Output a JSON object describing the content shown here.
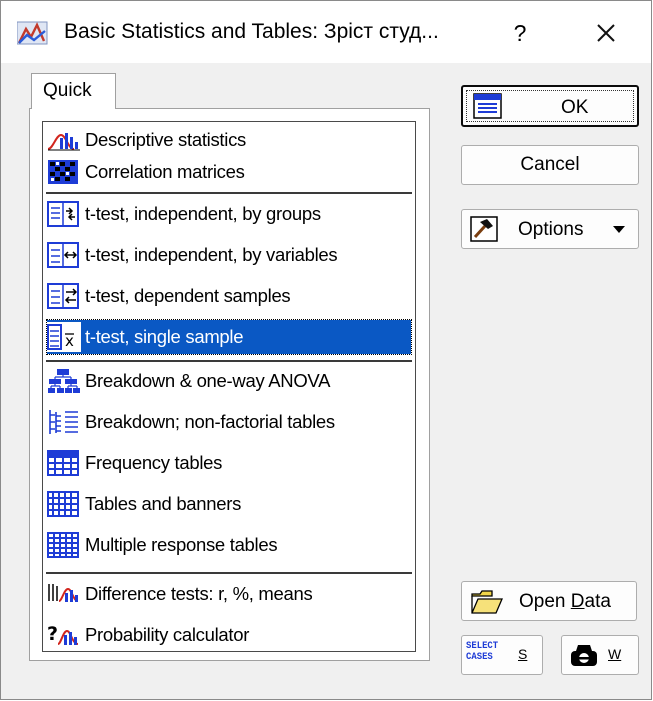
{
  "window": {
    "title": "Basic Statistics and Tables: Зріст студ...",
    "help_label": "?",
    "icon": "statistica-app-icon"
  },
  "tabs": [
    {
      "label": "Quick",
      "selected": true
    }
  ],
  "analysis_list": {
    "selected_index": 5,
    "groups": [
      {
        "items": [
          {
            "label": "Descriptive statistics",
            "icon": "descriptive-chart-icon"
          },
          {
            "label": "Correlation matrices",
            "icon": "correlation-matrix-icon"
          }
        ]
      },
      {
        "items": [
          {
            "label": "t-test, independent, by groups",
            "icon": "ttest-groups-icon"
          },
          {
            "label": "t-test, independent, by variables",
            "icon": "ttest-variables-icon"
          },
          {
            "label": "t-test, dependent samples",
            "icon": "ttest-dependent-icon"
          },
          {
            "label": "t-test, single sample",
            "icon": "ttest-single-icon"
          }
        ]
      },
      {
        "items": [
          {
            "label": "Breakdown & one-way ANOVA",
            "icon": "breakdown-tree-icon"
          },
          {
            "label": "Breakdown; non-factorial tables",
            "icon": "breakdown-nonfactorial-icon"
          },
          {
            "label": "Frequency tables",
            "icon": "frequency-table-icon"
          },
          {
            "label": "Tables and banners",
            "icon": "banner-table-icon"
          },
          {
            "label": "Multiple response tables",
            "icon": "multiple-response-icon"
          }
        ]
      },
      {
        "items": [
          {
            "label": "Difference tests: r, %, means",
            "icon": "difference-tests-icon"
          },
          {
            "label": "Probability calculator",
            "icon": "probability-calculator-icon"
          }
        ]
      }
    ]
  },
  "buttons": {
    "ok": "OK",
    "cancel": "Cancel",
    "options": "Options",
    "open_data_prefix": "Open ",
    "open_data_mnemonic": "D",
    "open_data_suffix": "ata",
    "select_cases_line1": "SELECT",
    "select_cases_line2": "CASES",
    "select_cases_key": "S",
    "weight_key": "W"
  },
  "colors": {
    "selection": "#0a58c4",
    "dialog_bg": "#f0f0f0",
    "icon_blue": "#1e3cd6"
  }
}
